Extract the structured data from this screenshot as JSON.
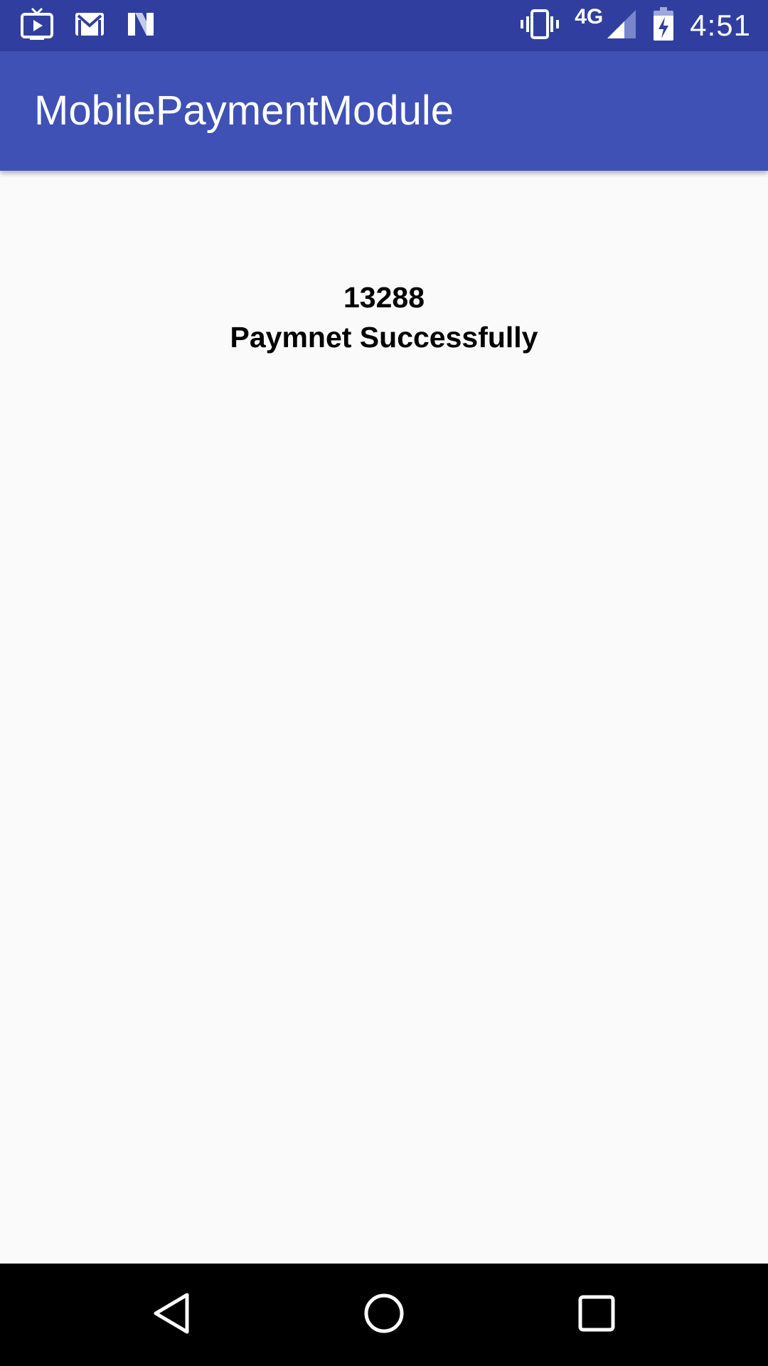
{
  "status_bar": {
    "left_icons": [
      "tv-play-icon",
      "gmail-icon",
      "n-logo-icon"
    ],
    "right_icons": [
      "vibrate-icon",
      "signal-icon",
      "battery-charging-icon"
    ],
    "network_type": "4G",
    "time": "4:51"
  },
  "app_bar": {
    "title": "MobilePaymentModule"
  },
  "content": {
    "amount": "13288",
    "message": "Paymnet Successfully"
  },
  "nav_bar": {
    "buttons": [
      "back-icon",
      "home-icon",
      "recents-icon"
    ]
  },
  "colors": {
    "status_bar": "#303f9f",
    "app_bar": "#3f51b5",
    "background": "#fafafa",
    "nav_bar": "#000000",
    "text": "#000000"
  }
}
